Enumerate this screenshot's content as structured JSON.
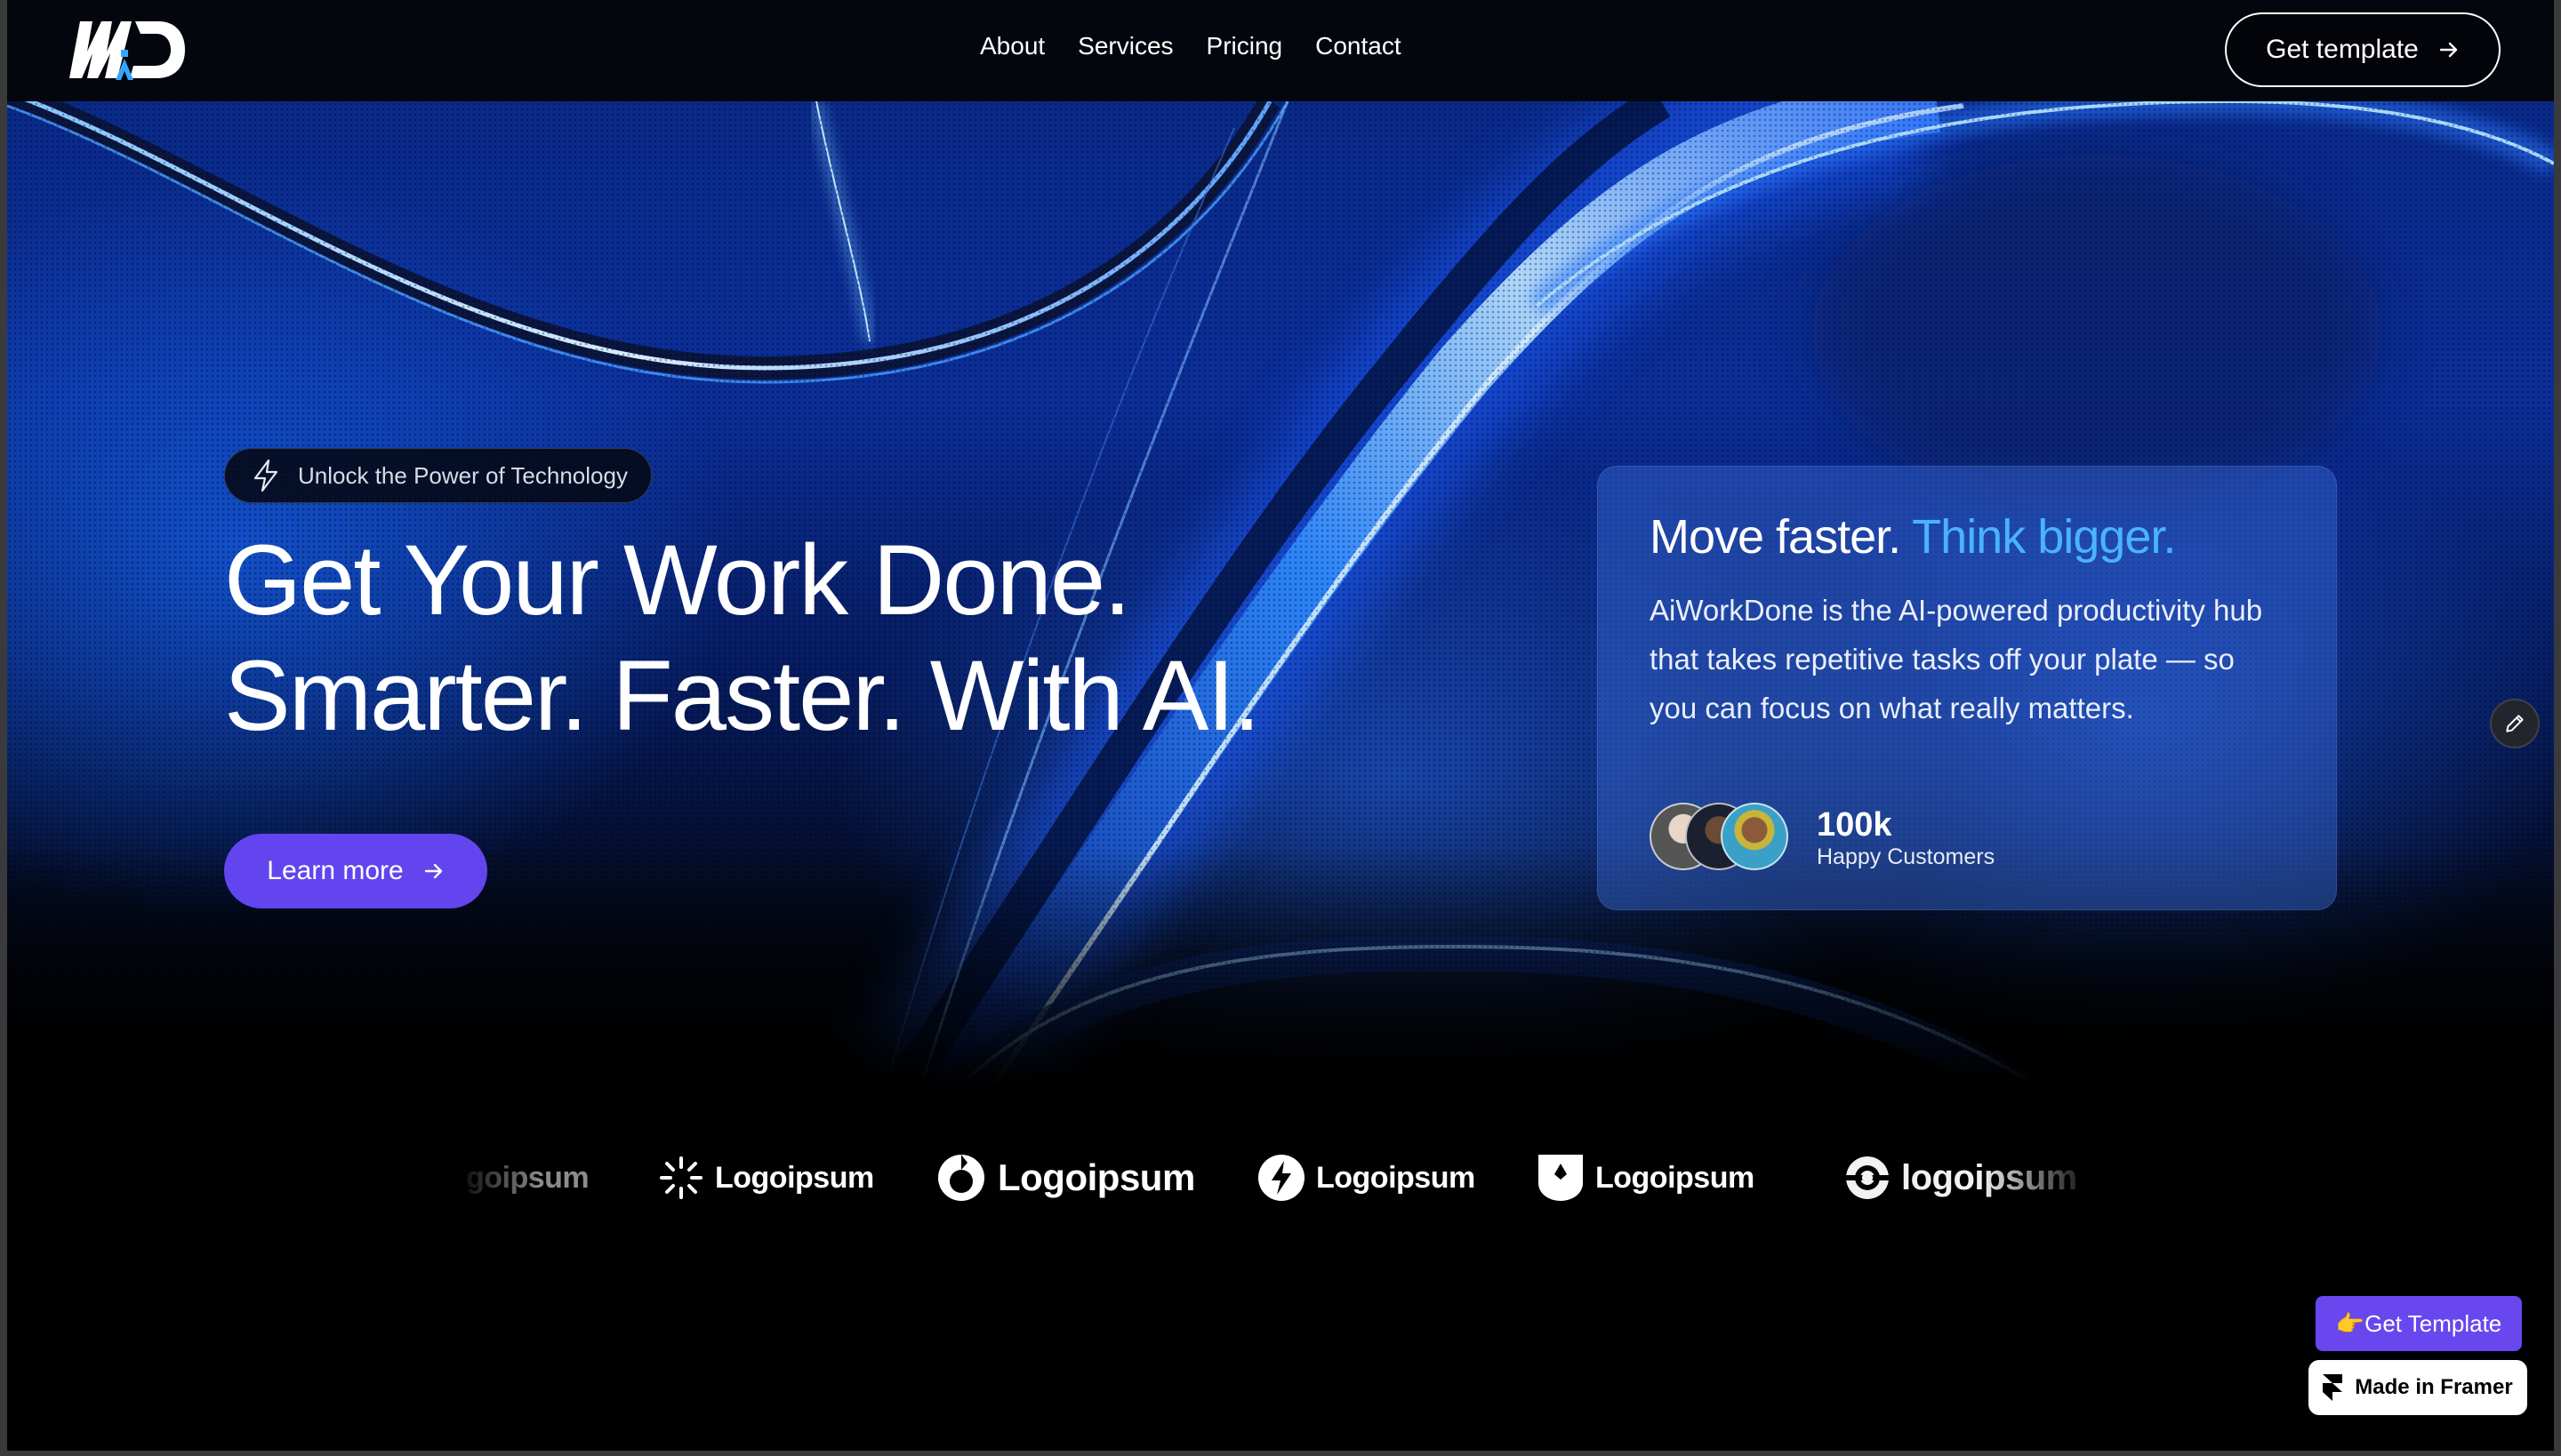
{
  "brand": {
    "logo_letters": "ᴀD"
  },
  "nav": {
    "links": [
      "About",
      "Services",
      "Pricing",
      "Contact"
    ],
    "cta_label": "Get template"
  },
  "hero": {
    "pill_label": "Unlock the Power of Technology",
    "headline_line1": "Get Your Work Done.",
    "headline_line2": "Smarter. Faster. With AI.",
    "cta_label": "Learn more"
  },
  "card": {
    "title_plain": "Move faster.",
    "title_accent": "Think bigger.",
    "body": "AiWorkDone is the AI-powered productivity hub that takes repetitive tasks off your plate — so you can focus on what really matters.",
    "customers_count": "100k",
    "customers_label": "Happy Customers"
  },
  "logos": [
    "goipsum",
    "Logoipsum",
    "Logoipsum",
    "Logoipsum",
    "Logoipsum",
    "logoipsum"
  ],
  "floating": {
    "template_label": "👉Get Template",
    "framer_label": "Made in Framer"
  },
  "colors": {
    "accent_purple": "#6245ee",
    "accent_blue_text": "#4ab3ff",
    "background": "#000000"
  },
  "icons": [
    "lightning-icon",
    "arrow-right-icon",
    "pencil-icon",
    "framer-icon"
  ]
}
